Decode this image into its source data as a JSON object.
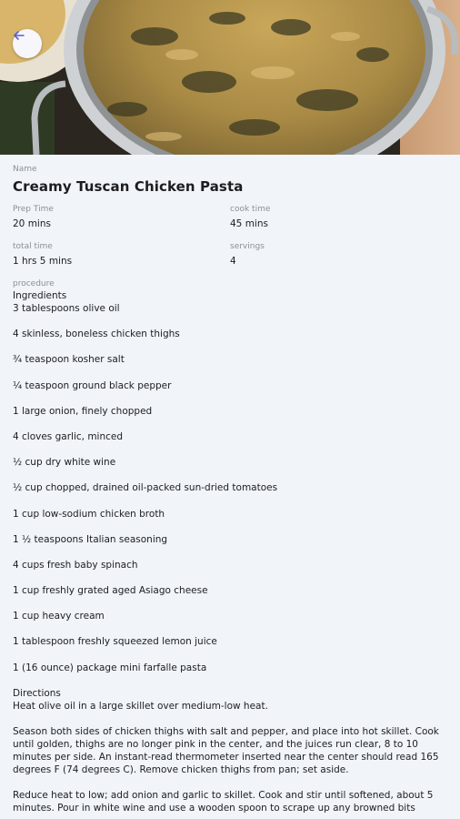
{
  "recipe": {
    "name_label": "Name",
    "name": "Creamy Tuscan Chicken Pasta",
    "prep_label": "Prep Time",
    "prep_value": "20 mins",
    "cook_label": "cook time",
    "cook_value": "45 mins",
    "total_label": "total time",
    "total_value": "1 hrs 5 mins",
    "servings_label": "servings",
    "servings_value": "4",
    "procedure_label": "procedure",
    "ingredients_heading": "Ingredients",
    "ingredients": [
      "3 tablespoons olive oil",
      "4 skinless, boneless chicken thighs",
      "¾ teaspoon kosher salt",
      "¼ teaspoon ground black pepper",
      "1 large onion, finely chopped",
      "4 cloves garlic, minced",
      "½ cup dry white wine",
      "½ cup chopped, drained oil-packed sun-dried tomatoes",
      "1 cup low-sodium chicken broth",
      "1 ½ teaspoons Italian seasoning",
      "4 cups fresh baby spinach",
      "1 cup freshly grated aged Asiago cheese",
      "1 cup heavy cream",
      "1 tablespoon freshly squeezed lemon juice",
      "1 (16 ounce) package mini farfalle pasta"
    ],
    "directions_heading": "Directions",
    "directions": [
      "Heat olive oil in a large skillet over medium-low heat.",
      "Season both sides of chicken thighs with salt and pepper, and place into hot skillet. Cook until golden, thighs are no longer pink in the center, and the juices run clear, 8 to 10 minutes per side. An instant-read thermometer inserted near the center should read 165 degrees F (74 degrees C). Remove chicken thighs from pan; set aside.",
      "Reduce heat to low; add onion and garlic to skillet. Cook and stir until softened, about 5 minutes. Pour in white wine and use a wooden spoon to scrape up any browned bits"
    ]
  },
  "icons": {
    "back": "arrow-left-icon"
  },
  "colors": {
    "accent": "#5b5bd6",
    "background": "#f1f4f8"
  }
}
